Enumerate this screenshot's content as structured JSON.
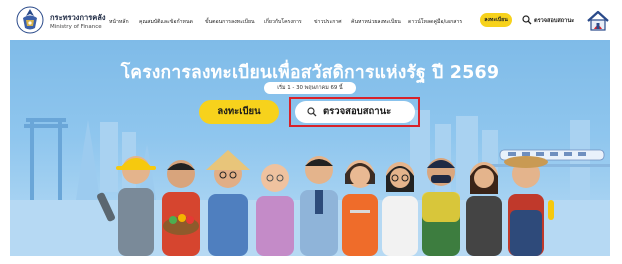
{
  "header": {
    "org_name_th": "กระทรวงการคลัง",
    "org_name_en": "Ministry of Finance",
    "nav": [
      {
        "label": "หน้าหลัก"
      },
      {
        "label": "คุณสมบัติและข้อกำหนด"
      },
      {
        "label": "ขั้นตอนการลงทะเบียน"
      },
      {
        "label": "เกี่ยวกับโครงการ"
      },
      {
        "label": "ข่าวประกาศ"
      },
      {
        "label": "ค้นหาหน่วยลงทะเบียน"
      },
      {
        "label": "ดาวน์โหลดคู่มือ/เอกสาร"
      }
    ],
    "register_label": "ลงทะเบียน",
    "check_status_label": "ตรวจสอบสถานะ"
  },
  "hero": {
    "title": "โครงการลงทะเบียนเพื่อสวัสดิการแห่งรัฐ ปี 2569",
    "date_range": "เริ่ม 1 - 30 พฤษภาคม 69 นี้",
    "register_button": "ลงทะเบียน",
    "check_status_button": "ตรวจสอบสถานะ"
  },
  "colors": {
    "accent_yellow": "#f7d21c",
    "sky_blue": "#8fc6ee",
    "highlight_red": "#d8222a",
    "title_text": "#ffffff"
  },
  "icons": [
    "ministry-seal-icon",
    "search-icon",
    "house-logo-icon"
  ]
}
